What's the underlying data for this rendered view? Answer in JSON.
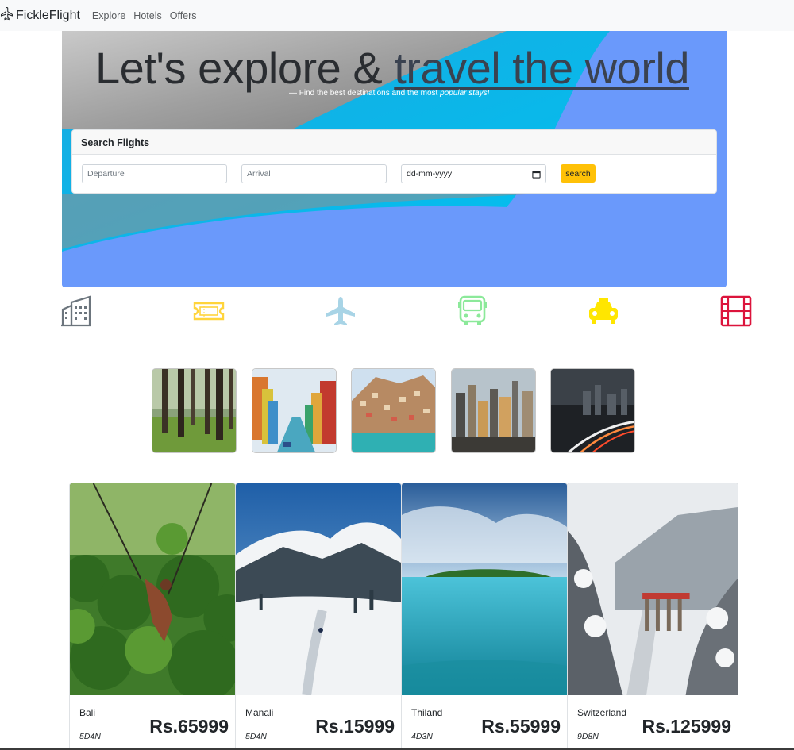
{
  "navbar": {
    "brand": "FickleFlight",
    "links": [
      "Explore",
      "Hotels",
      "Offers"
    ]
  },
  "hero": {
    "title_part1": "Let's explore & ",
    "title_part2": "travel the world",
    "subtitle_part1": "— Find the best destinations and the most ",
    "subtitle_em": "popular stays!"
  },
  "search": {
    "header": "Search Flights",
    "departure_placeholder": "Departure",
    "arrival_placeholder": "Arrival",
    "date_value": "dd-mm-yyyy",
    "button_label": "search"
  },
  "categories": [
    {
      "icon": "building-icon",
      "color": "#6c757d"
    },
    {
      "icon": "ticket-icon",
      "color": "#ffd43b"
    },
    {
      "icon": "plane-icon",
      "color": "#a8d4e6"
    },
    {
      "icon": "bus-icon",
      "color": "#8ce99a"
    },
    {
      "icon": "taxi-icon",
      "color": "#ffe600"
    },
    {
      "icon": "film-icon",
      "color": "#dc143c"
    }
  ],
  "destinations": [
    {
      "name": "Bali",
      "duration": "5D4N",
      "price": "Rs.65999"
    },
    {
      "name": "Manali",
      "duration": "5D4N",
      "price": "Rs.15999"
    },
    {
      "name": "Thiland",
      "duration": "4D3N",
      "price": "Rs.55999"
    },
    {
      "name": "Switzerland",
      "duration": "9D8N",
      "price": "Rs.125999"
    }
  ],
  "colors": {
    "hero_blue": "#6a99fb",
    "hero_cyan": "#00b4e6",
    "accent_button": "#ffc107"
  }
}
